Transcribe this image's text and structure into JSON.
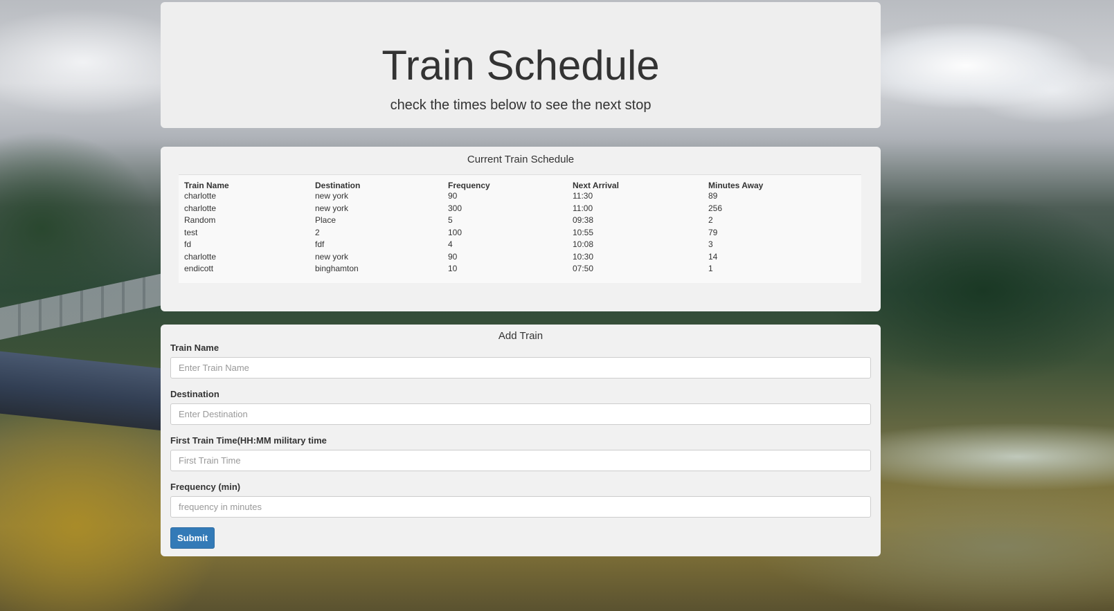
{
  "header": {
    "title": "Train Schedule",
    "subtitle": "check the times below to see the next stop"
  },
  "schedule": {
    "title": "Current Train Schedule",
    "columns": [
      "Train Name",
      "Destination",
      "Frequency",
      "Next Arrival",
      "Minutes Away"
    ],
    "rows": [
      [
        "charlotte",
        "new york",
        "90",
        "11:30",
        "89"
      ],
      [
        "charlotte",
        "new york",
        "300",
        "11:00",
        "256"
      ],
      [
        "Random",
        "Place",
        "5",
        "09:38",
        "2"
      ],
      [
        "test",
        "2",
        "100",
        "10:55",
        "79"
      ],
      [
        "fd",
        "fdf",
        "4",
        "10:08",
        "3"
      ],
      [
        "charlotte",
        "new york",
        "90",
        "10:30",
        "14"
      ],
      [
        "endicott",
        "binghamton",
        "10",
        "07:50",
        "1"
      ]
    ]
  },
  "form": {
    "title": "Add Train",
    "train_name_label": "Train Name",
    "train_name_placeholder": "Enter Train Name",
    "destination_label": "Destination",
    "destination_placeholder": "Enter Destination",
    "first_time_label": "First Train Time(HH:MM military time",
    "first_time_placeholder": "First Train Time",
    "frequency_label": "Frequency (min)",
    "frequency_placeholder": "frequency in minutes",
    "submit_label": "Submit"
  },
  "colors": {
    "panel_background": "#eeeeee",
    "submit_button": "#337ab7"
  }
}
